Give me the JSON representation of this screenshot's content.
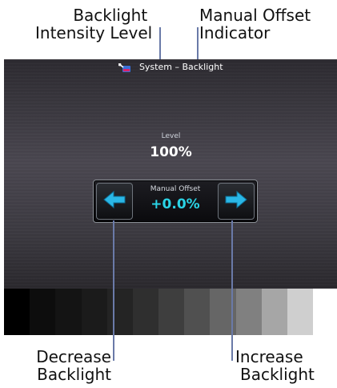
{
  "callouts": {
    "backlight_intensity_level": [
      "Backlight",
      "Intensity Level"
    ],
    "manual_offset_indicator": [
      "Manual Offset",
      "Indicator"
    ],
    "decrease_backlight": [
      "Decrease",
      "Backlight"
    ],
    "increase_backlight": [
      "Increase",
      "Backlight"
    ]
  },
  "screen": {
    "title": "System – Backlight",
    "title_icon": "wrench-display-icon",
    "level_label": "Level",
    "level_value": "100%",
    "manual_offset_label": "Manual Offset",
    "manual_offset_value": "+0.0%",
    "decrease_icon": "arrow-left-icon",
    "increase_icon": "arrow-right-icon",
    "accent_color": "#2ad4e6"
  },
  "gray_scale": [
    "#000000",
    "#0d0d0d",
    "#141414",
    "#1b1b1b",
    "#242424",
    "#2f2f2f",
    "#3e3e3e",
    "#505050",
    "#666666",
    "#808080",
    "#a6a6a6",
    "#cfcfcf"
  ]
}
